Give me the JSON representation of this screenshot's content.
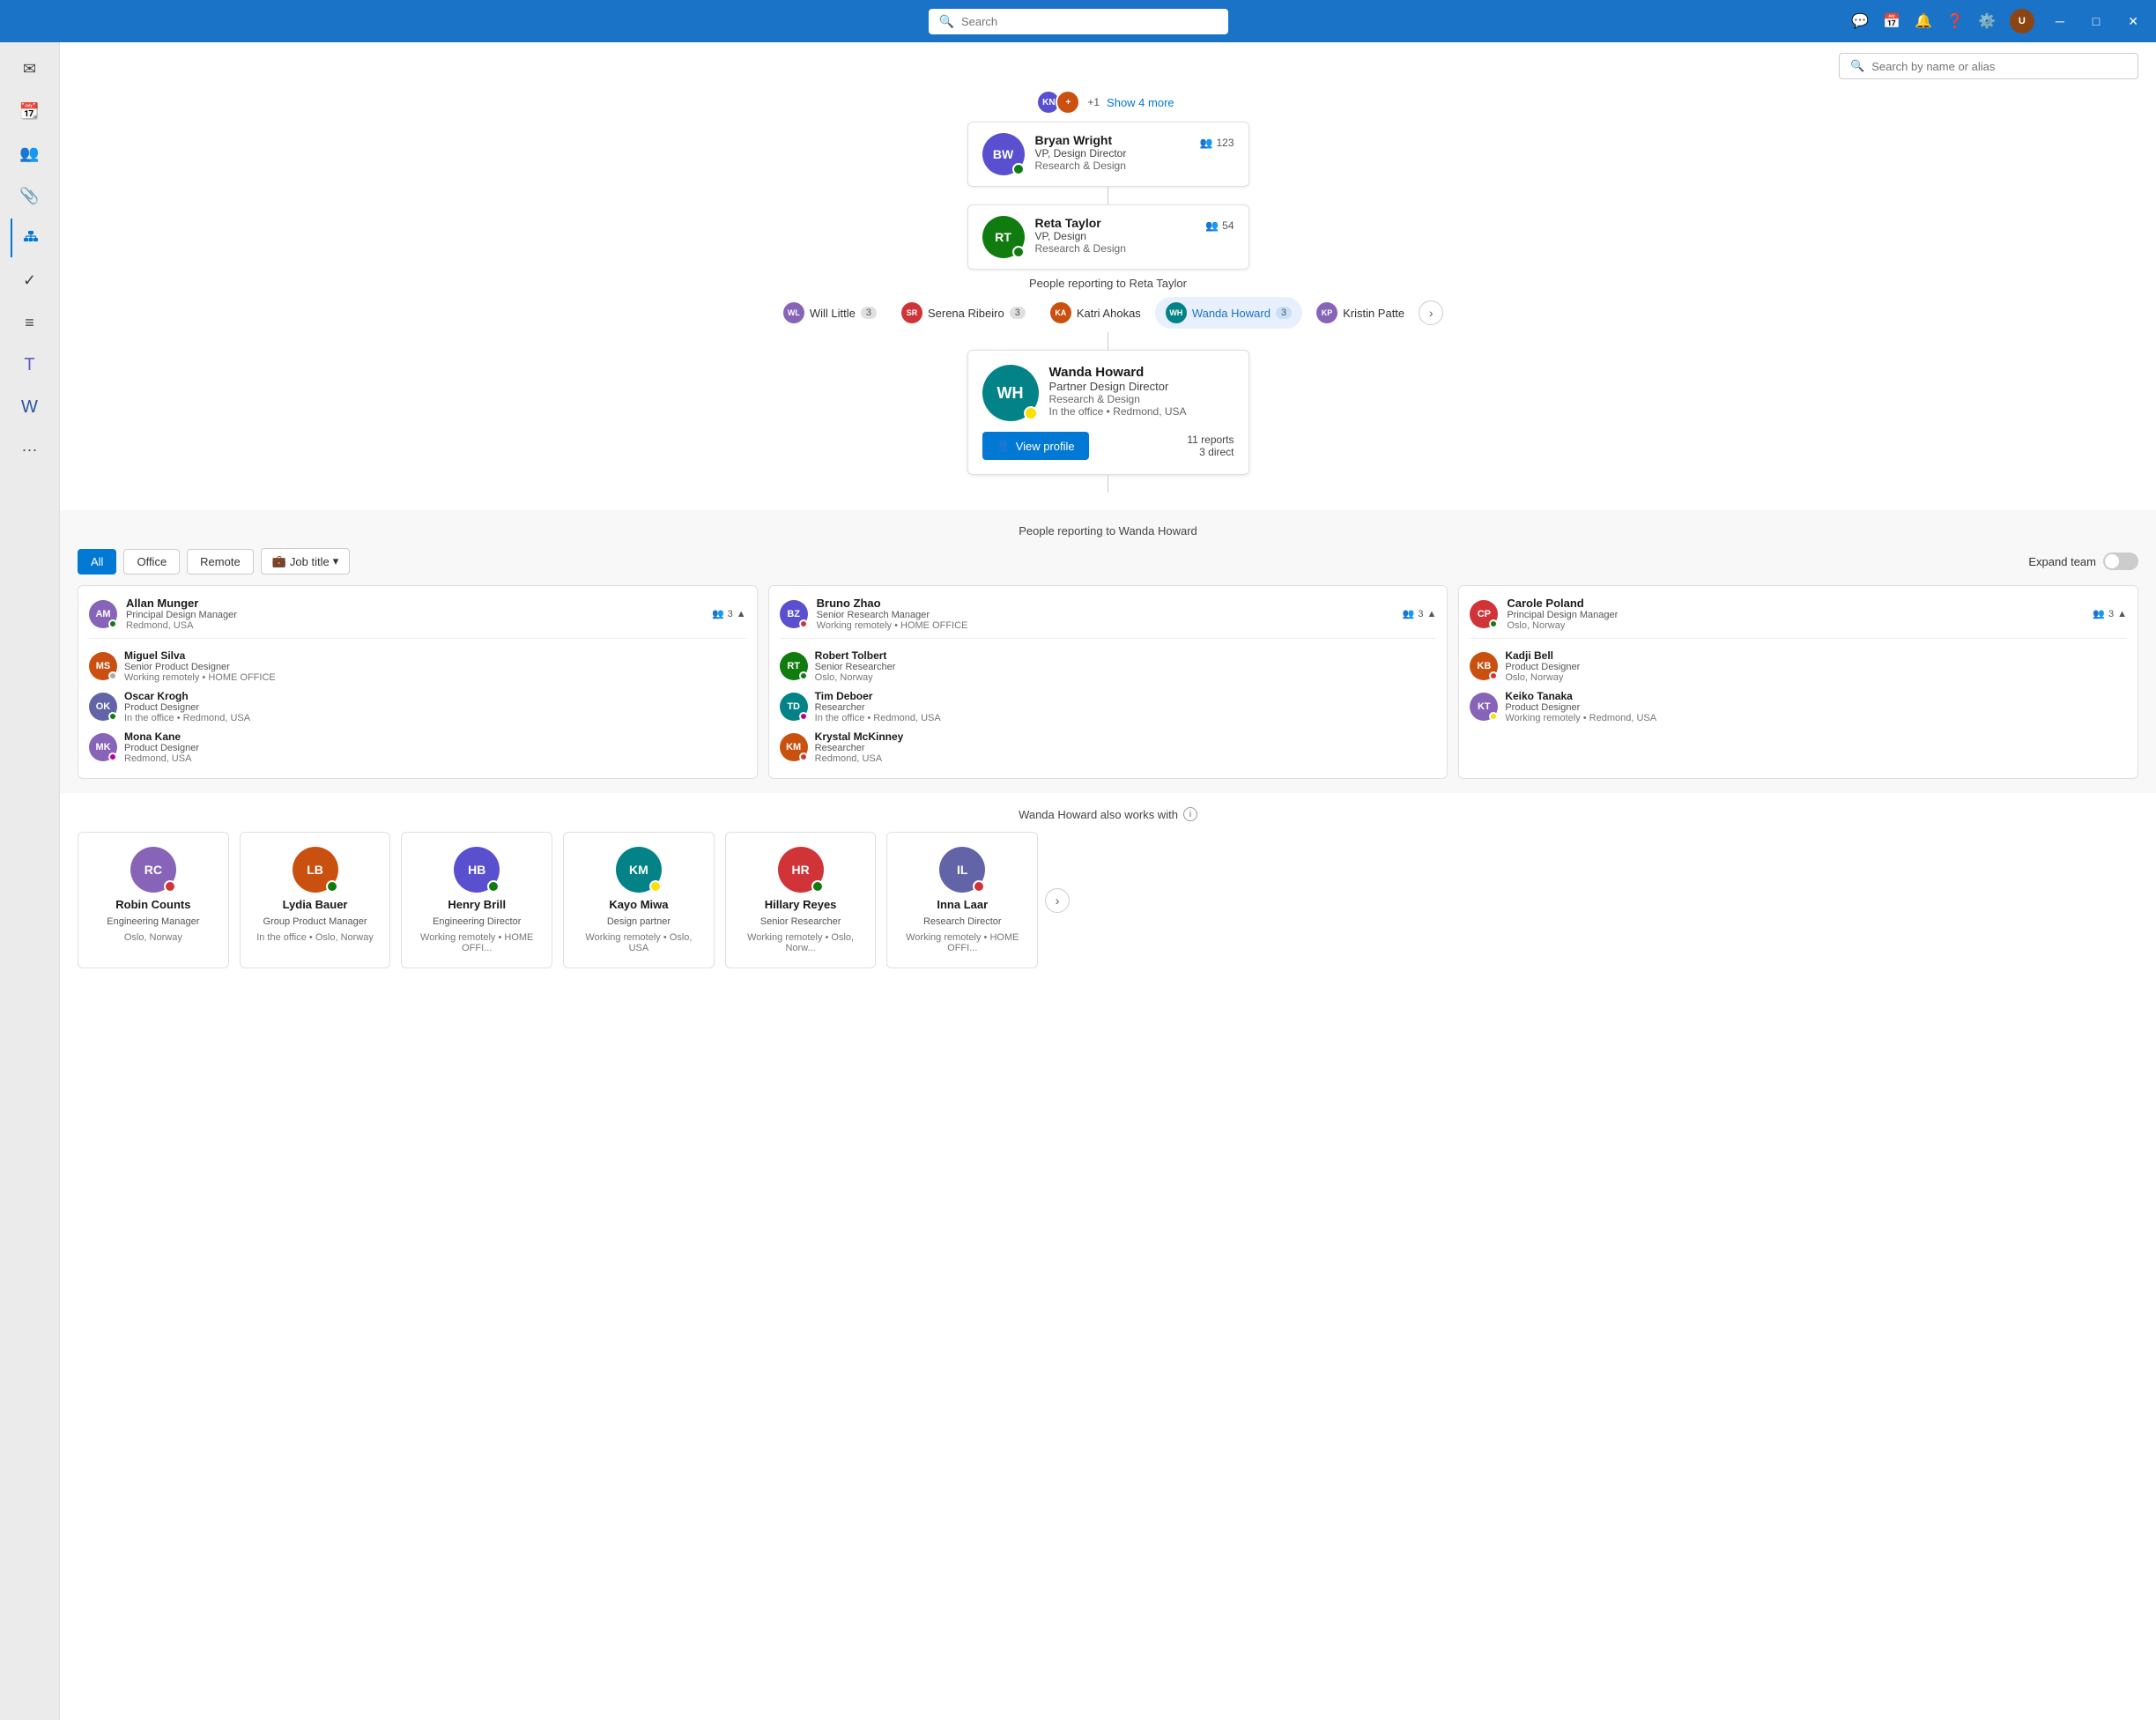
{
  "titlebar": {
    "search_placeholder": "Search",
    "icons": [
      "chat",
      "calendar",
      "bell",
      "help",
      "settings"
    ]
  },
  "org_search": {
    "placeholder": "Search by name or alias"
  },
  "show_more": {
    "count": "+1",
    "label": "Show 4 more"
  },
  "org_nodes": [
    {
      "name": "Bryan Wright",
      "title": "VP, Design Director",
      "dept": "Research & Design",
      "count": 123,
      "status": "green",
      "initials": "BW",
      "bg": "#5a4fcf"
    },
    {
      "name": "Reta Taylor",
      "title": "VP, Design",
      "dept": "Research & Design",
      "count": 54,
      "status": "green",
      "initials": "RT",
      "bg": "#107c10"
    }
  ],
  "reporting_to_reta": "People reporting to Reta Taylor",
  "reporter_tabs": [
    {
      "name": "Will Little",
      "badge": 3,
      "active": false,
      "initials": "WL",
      "bg": "#8764b8"
    },
    {
      "name": "Serena Ribeiro",
      "badge": 3,
      "active": false,
      "initials": "SR",
      "bg": "#d13438"
    },
    {
      "name": "Katri Ahokas",
      "badge": null,
      "active": false,
      "initials": "KA",
      "bg": "#ca5010"
    },
    {
      "name": "Wanda Howard",
      "badge": 3,
      "active": true,
      "initials": "WH",
      "bg": "#038387"
    },
    {
      "name": "Kristin Patte",
      "badge": null,
      "active": false,
      "initials": "KP",
      "bg": "#8764b8"
    }
  ],
  "selected_person": {
    "name": "Wanda Howard",
    "title": "Partner Design Director",
    "dept": "Research & Design",
    "location": "In the office • Redmond, USA",
    "reports": "11 reports",
    "direct": "3 direct",
    "status": "yellow",
    "initials": "WH",
    "bg": "#038387"
  },
  "view_profile_label": "View profile",
  "reporting_to_wanda": "People reporting to Wanda Howard",
  "filters": {
    "all": "All",
    "office": "Office",
    "remote": "Remote",
    "job_title": "Job title"
  },
  "expand_team": "Expand team",
  "team_groups": [
    {
      "manager": {
        "name": "Allan Munger",
        "title": "Principal Design Manager",
        "location": "Redmond, USA",
        "count": 3,
        "status": "green",
        "initials": "AM",
        "bg": "#8764b8"
      },
      "members": [
        {
          "name": "Miguel Silva",
          "title": "Senior Product Designer",
          "location": "Working remotely • HOME OFFICE",
          "status": "none",
          "initials": "MS",
          "bg": "#ca5010"
        },
        {
          "name": "Oscar Krogh",
          "title": "Product Designer",
          "location": "In the office • Redmond, USA",
          "status": "green",
          "initials": "OK",
          "bg": "#6264a7"
        },
        {
          "name": "Mona Kane",
          "title": "Product Designer",
          "location": "Redmond, USA",
          "status": "purple",
          "initials": "MK",
          "bg": "#8764b8"
        }
      ]
    },
    {
      "manager": {
        "name": "Bruno Zhao",
        "title": "Senior Research Manager",
        "location": "Working remotely • HOME OFFICE",
        "count": 3,
        "status": "red",
        "initials": "BZ",
        "bg": "#5a4fcf"
      },
      "members": [
        {
          "name": "Robert Tolbert",
          "title": "Senior Researcher",
          "location": "Oslo, Norway",
          "status": "green",
          "initials": "RT",
          "bg": "#107c10"
        },
        {
          "name": "Tim Deboer",
          "title": "Researcher",
          "location": "In the office • Redmond, USA",
          "status": "purple",
          "initials": "TD",
          "bg": "#038387"
        },
        {
          "name": "Krystal McKinney",
          "title": "Researcher",
          "location": "Redmond, USA",
          "status": "red",
          "initials": "KM",
          "bg": "#ca5010"
        }
      ]
    },
    {
      "manager": {
        "name": "Carole Poland",
        "title": "Principal Design Manager",
        "location": "Oslo, Norway",
        "count": 3,
        "status": "green",
        "initials": "CP",
        "bg": "#d13438"
      },
      "members": [
        {
          "name": "Kadji Bell",
          "title": "Product Designer",
          "location": "Oslo, Norway",
          "status": "red",
          "initials": "KB",
          "bg": "#ca5010"
        },
        {
          "name": "Keiko Tanaka",
          "title": "Product Designer",
          "location": "Working remotely • Redmond, USA",
          "status": "yellow",
          "initials": "KT",
          "bg": "#8764b8"
        }
      ]
    }
  ],
  "also_works_with": "Wanda Howard also works with",
  "collaborators": [
    {
      "name": "Robin Counts",
      "title": "Engineering Manager",
      "location": "Oslo, Norway",
      "status": "red",
      "initials": "RC",
      "bg": "#8764b8"
    },
    {
      "name": "Lydia Bauer",
      "title": "Group Product Manager",
      "location": "In the office • Oslo, Norway",
      "status": "green",
      "initials": "LB",
      "bg": "#ca5010"
    },
    {
      "name": "Henry Brill",
      "title": "Engineering Director",
      "location": "Working remotely • HOME OFFI...",
      "status": "green",
      "initials": "HB",
      "bg": "#5a4fcf"
    },
    {
      "name": "Kayo Miwa",
      "title": "Design partner",
      "location": "Working remotely • Oslo, USA",
      "status": "yellow",
      "initials": "KM",
      "bg": "#038387"
    },
    {
      "name": "Hillary Reyes",
      "title": "Senior Researcher",
      "location": "Working remotely • Oslo, Norw...",
      "status": "green",
      "initials": "HR",
      "bg": "#d13438"
    },
    {
      "name": "Inna Laar",
      "title": "Research Director",
      "location": "Working remotely • HOME OFFI...",
      "status": "red",
      "initials": "IL",
      "bg": "#6264a7"
    }
  ]
}
